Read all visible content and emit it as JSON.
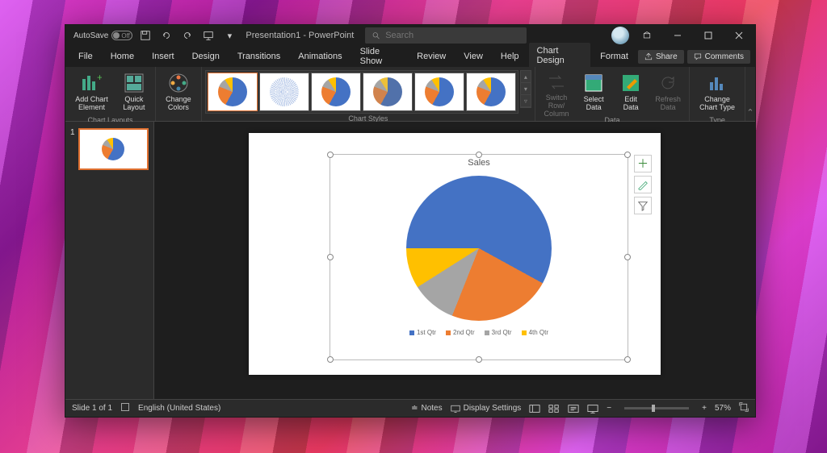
{
  "titlebar": {
    "autosave_label": "AutoSave",
    "autosave_state": "Off",
    "doc_name": "Presentation1",
    "app_name": "PowerPoint",
    "search_placeholder": "Search"
  },
  "tabs": {
    "items": [
      "File",
      "Home",
      "Insert",
      "Design",
      "Transitions",
      "Animations",
      "Slide Show",
      "Review",
      "View",
      "Help",
      "Chart Design",
      "Format"
    ],
    "active": "Chart Design",
    "share": "Share",
    "comments": "Comments"
  },
  "ribbon": {
    "chart_layouts_label": "Chart Layouts",
    "add_chart_element": "Add Chart Element",
    "quick_layout": "Quick Layout",
    "change_colors": "Change Colors",
    "chart_styles_label": "Chart Styles",
    "data_label": "Data",
    "switch_row": "Switch Row/ Column",
    "select_data": "Select Data",
    "edit_data": "Edit Data",
    "refresh_data": "Refresh Data",
    "type_label": "Type",
    "change_chart_type": "Change Chart Type"
  },
  "slide_panel": {
    "slide_number": "1"
  },
  "chart_data": {
    "type": "pie",
    "title": "Sales",
    "categories": [
      "1st Qtr",
      "2nd Qtr",
      "3rd Qtr",
      "4th Qtr"
    ],
    "values": [
      58,
      23,
      10,
      9
    ],
    "colors": [
      "#4472c4",
      "#ed7d31",
      "#a5a5a5",
      "#ffc000"
    ]
  },
  "statusbar": {
    "slide_info": "Slide 1 of 1",
    "language": "English (United States)",
    "notes": "Notes",
    "display_settings": "Display Settings",
    "zoom": "57%"
  }
}
